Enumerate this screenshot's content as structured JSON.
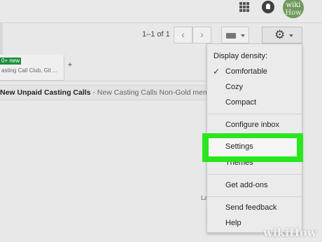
{
  "header": {
    "apps_icon": "grid-apps-icon",
    "notifications_icon": "bell-icon",
    "avatar_line1": "wiki",
    "avatar_line2": "How"
  },
  "toolbar": {
    "pagination": "1–1 of 1",
    "prev_icon": "‹",
    "next_icon": "›",
    "keyboard_icon": "keyboard-icon",
    "settings_icon": "⚙"
  },
  "tab": {
    "badge": "0+ new",
    "subtitle": "asting Call Club, Git ...",
    "add": "+"
  },
  "email": {
    "subject": "New Unpaid Casting Calls",
    "snippet": " - New Casting Calls Non-Gold memb"
  },
  "footer_fragment": "La",
  "settings_menu": {
    "density_header": "Display density:",
    "check_mark": "✓",
    "comfortable": "Comfortable",
    "cozy": "Cozy",
    "compact": "Compact",
    "configure_inbox": "Configure inbox",
    "settings": "Settings",
    "themes": "Themes",
    "get_addons": "Get add-ons",
    "send_feedback": "Send feedback",
    "help": "Help"
  },
  "colors": {
    "highlight": "#29e61f",
    "badge_green": "#1e8e3e"
  },
  "watermark": "wikiHow"
}
